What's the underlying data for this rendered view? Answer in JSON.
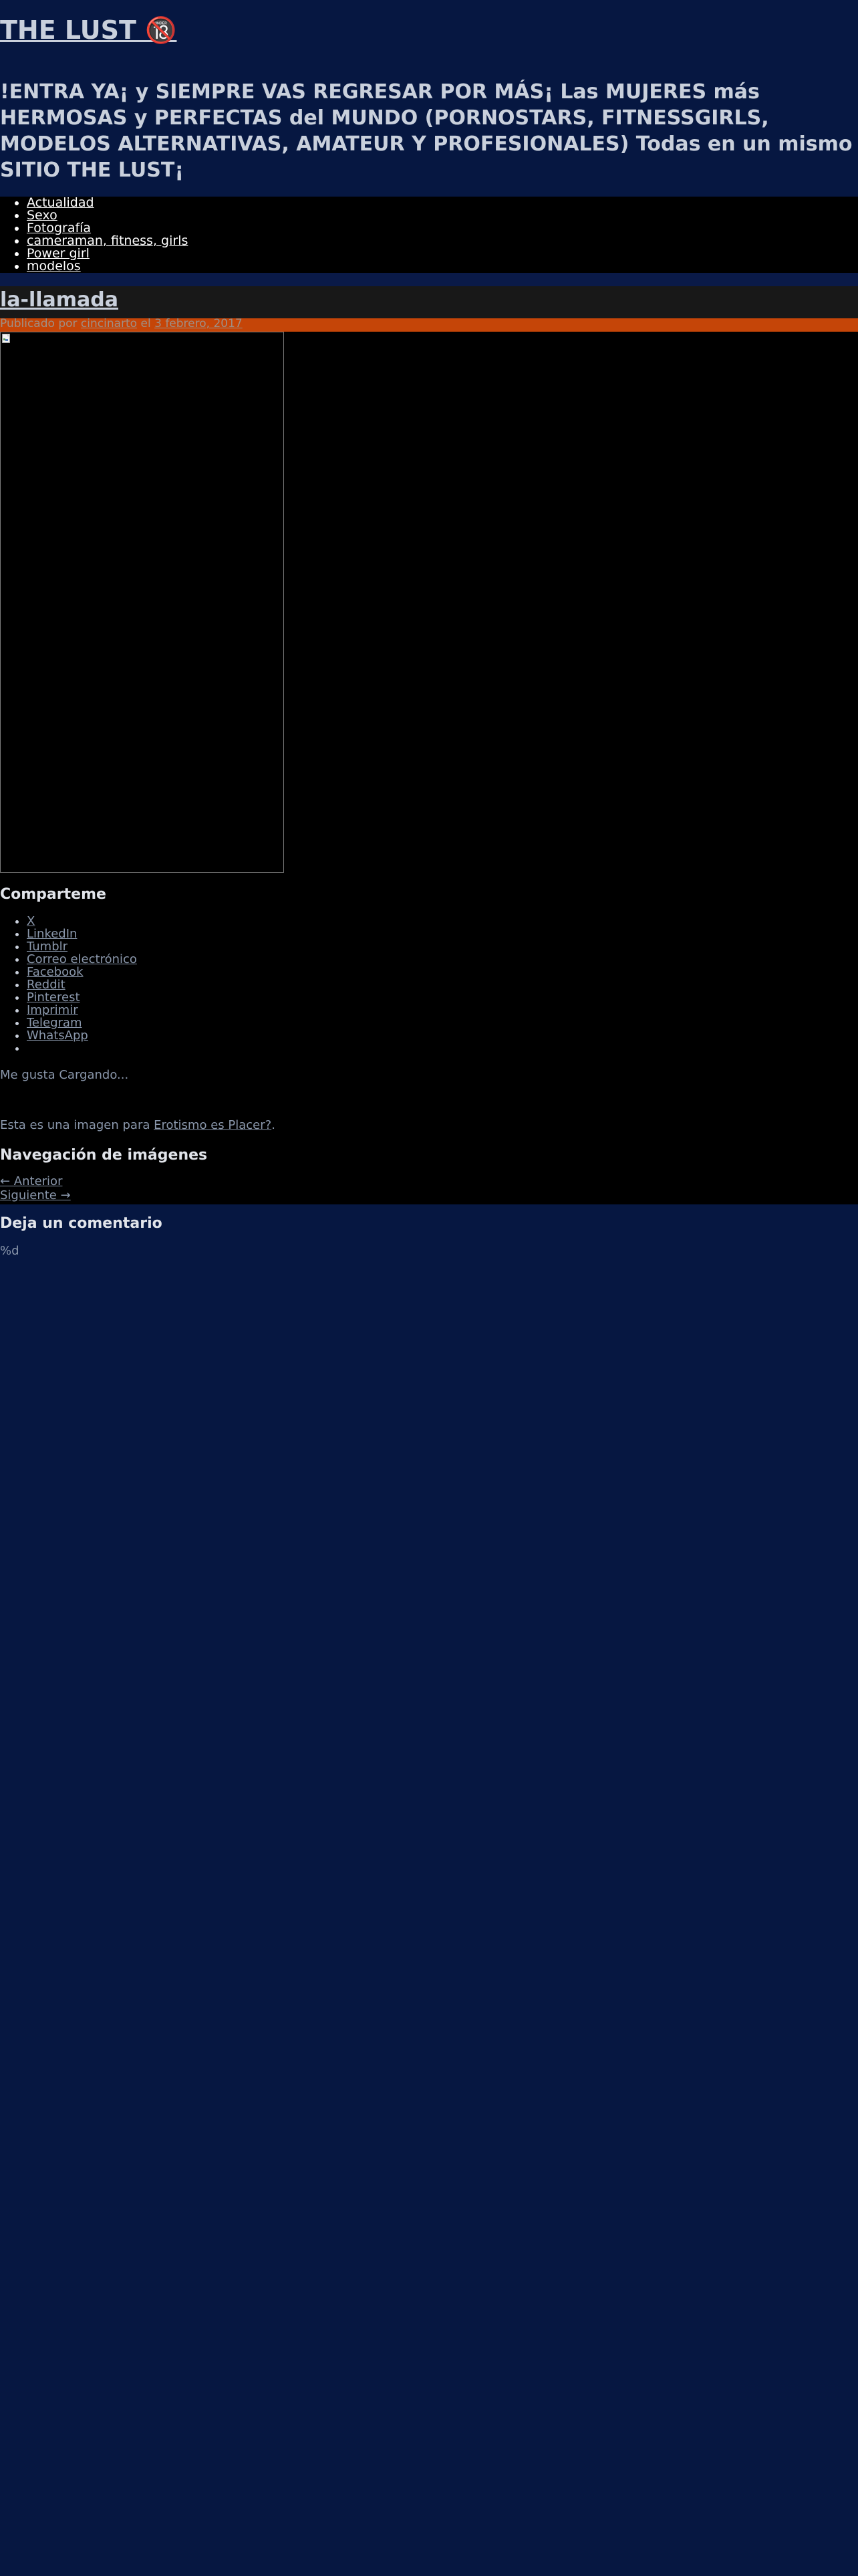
{
  "site": {
    "title": "THE LUST 🔞",
    "description": "!ENTRA YA¡ y SIEMPRE VAS REGRESAR POR MÁS¡ Las MUJERES más HERMOSAS y PERFECTAS del MUNDO (PORNOSTARS, FITNESSGIRLS, MODELOS ALTERNATIVAS, AMATEUR Y PROFESIONALES) Todas en un mismo SITIO THE LUST¡"
  },
  "nav": {
    "items": [
      {
        "label": "Actualidad"
      },
      {
        "label": "Sexo"
      },
      {
        "label": "Fotografía"
      },
      {
        "label": "cameraman, fitness, girls"
      },
      {
        "label": "Power girl"
      },
      {
        "label": "modelos"
      }
    ]
  },
  "entry": {
    "title": "la-llamada",
    "meta_prefix": "Publicado por ",
    "author": "cincinarto",
    "meta_mid": " el ",
    "date": "3 febrero, 2017",
    "image_alt": "la-llamada"
  },
  "share": {
    "heading": "Comparteme",
    "items": [
      {
        "label": "X"
      },
      {
        "label": "LinkedIn"
      },
      {
        "label": "Tumblr"
      },
      {
        "label": "Correo electrónico"
      },
      {
        "label": "Facebook"
      },
      {
        "label": "Reddit"
      },
      {
        "label": "Pinterest"
      },
      {
        "label": "Imprimir"
      },
      {
        "label": "Telegram"
      },
      {
        "label": "WhatsApp"
      },
      {
        "label": ""
      }
    ]
  },
  "likes": {
    "text": "Me gusta Cargando..."
  },
  "attachment": {
    "prefix": "Esta es una imagen para ",
    "link": "Erotismo es Placer?",
    "suffix": "."
  },
  "image_nav": {
    "heading": "Navegación de imágenes",
    "prev": "← Anterior",
    "next": "Siguiente →"
  },
  "comments": {
    "heading": "Deja un comentario",
    "footer_token": "%d"
  },
  "colors": {
    "page_bg": "#061741",
    "nav_bg": "#000000",
    "meta_bar": "#c54508",
    "title_bar": "#181818"
  }
}
